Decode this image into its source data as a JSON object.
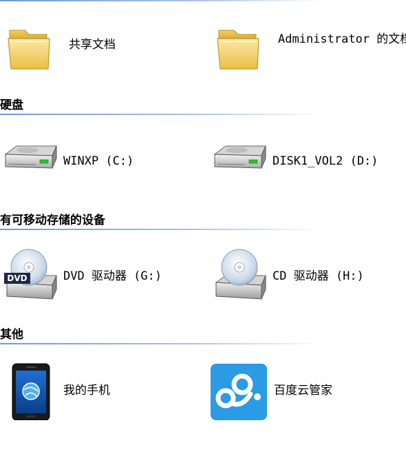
{
  "sections": {
    "top": {
      "items": [
        {
          "label": "共享文档",
          "icon": "folder-icon"
        },
        {
          "label": "Administrator 的文档",
          "icon": "folder-icon"
        }
      ]
    },
    "hard_disks": {
      "title": "硬盘",
      "items": [
        {
          "label": "WINXP (C:)",
          "icon": "hard-drive-icon"
        },
        {
          "label": "DISK1_VOL2 (D:)",
          "icon": "hard-drive-icon"
        }
      ]
    },
    "removable": {
      "title": "有可移动存储的设备",
      "items": [
        {
          "label": "DVD 驱动器 (G:)",
          "icon": "dvd-drive-icon",
          "badge": "DVD"
        },
        {
          "label": "CD 驱动器 (H:)",
          "icon": "cd-drive-icon"
        }
      ]
    },
    "other": {
      "title": "其他",
      "items": [
        {
          "label": "我的手机",
          "icon": "mobile-phone-icon"
        },
        {
          "label": "百度云管家",
          "icon": "baidu-cloud-icon"
        }
      ]
    }
  },
  "colors": {
    "header_rule": "#6f97d9",
    "folder": "#f6d774",
    "baidu_blue": "#2a9be4"
  }
}
